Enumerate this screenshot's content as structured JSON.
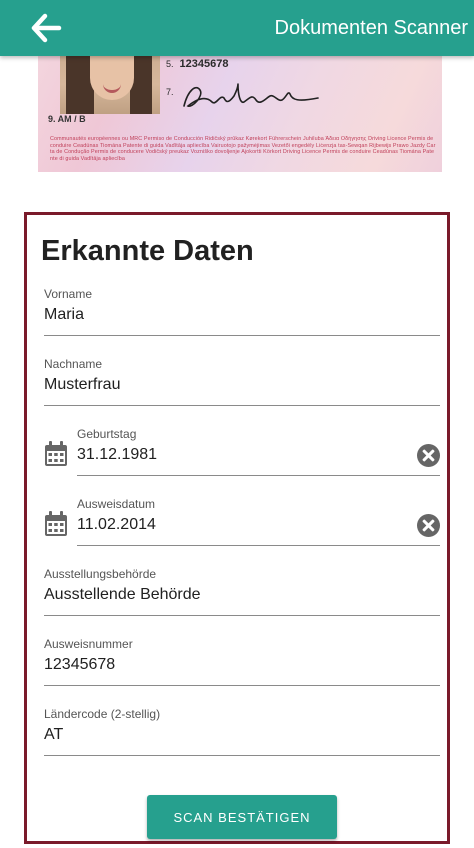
{
  "header": {
    "back_icon": "arrow-left-icon",
    "title": "Dokumenten Scanner",
    "color": "#26a08e"
  },
  "document_image": {
    "number_label": "5.",
    "number_value": "12345678",
    "signature_label": "7.",
    "class_line": "9. AM / B",
    "fine_print": "Communautés européennes ou MRC Permiso de Conducción Řidičský průkaz Kørekort Führerschein Juhiluba Άδεια Οδήγησης Driving Licence Permis de conduire Ceadúnas Tiomána Patente di guida Vadītāja apliecība Vairuotojo pažymėjimas Vezetői engedély Liċenzja tas-Sewqan Rijbewijs Prawo Jazdy Carta de Condução Permis de conducere Vodičský preukaz Vozniško dovoljenje Ajokortti Körkort Driving Licence Permis de conduire Ceadúnas Tiomána Patente di guida Vadītāja apliecība"
  },
  "card": {
    "title": "Erkannte Daten",
    "border_color": "#7a1a2a",
    "fields": [
      {
        "label": "Vorname",
        "value": "Maria"
      },
      {
        "label": "Nachname",
        "value": "Musterfrau"
      },
      {
        "label": "Geburtstag",
        "value": "31.12.1981",
        "icon": "calendar-icon",
        "clear_icon": "clear-circle-icon"
      },
      {
        "label": "Ausweisdatum",
        "value": "11.02.2014",
        "icon": "calendar-icon",
        "clear_icon": "clear-circle-icon"
      },
      {
        "label": "Ausstellungsbehörde",
        "value": "Ausstellende Behörde"
      },
      {
        "label": "Ausweisnummer",
        "value": "12345678"
      },
      {
        "label": "Ländercode (2-stellig)",
        "value": "AT"
      }
    ],
    "confirm_label": "SCAN BESTÄTIGEN"
  }
}
